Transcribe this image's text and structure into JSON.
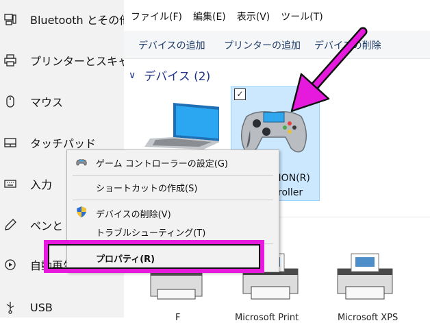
{
  "sidebar": {
    "items": [
      {
        "label": "Bluetooth とその他",
        "icon": "bluetooth-devices-icon"
      },
      {
        "label": "プリンターとスキャナー",
        "icon": "printer-icon"
      },
      {
        "label": "マウス",
        "icon": "mouse-icon"
      },
      {
        "label": "タッチパッド",
        "icon": "touchpad-icon"
      },
      {
        "label": "入力",
        "icon": "keyboard-icon"
      },
      {
        "label": "ペンと W",
        "icon": "pen-icon"
      },
      {
        "label": "自動再生",
        "icon": "autoplay-icon"
      },
      {
        "label": "USB",
        "icon": "usb-icon"
      }
    ]
  },
  "menubar": {
    "items": [
      "ファイル(F)",
      "編集(E)",
      "表示(V)",
      "ツール(T)"
    ]
  },
  "toolbar": {
    "add_device": "デバイスの追加",
    "add_printer": "プリンターの追加",
    "remove_device": "デバイスの削除"
  },
  "devices": {
    "group_title": "デバイス (2)",
    "controller_label_1": "TION(R)",
    "controller_label_2": "roller",
    "checkbox_mark": "✓"
  },
  "context_menu": {
    "items": [
      {
        "label": "ゲーム コントローラーの設定(G)",
        "icon": "gamepad-icon"
      },
      {
        "label": "ショートカットの作成(S)"
      },
      {
        "label": "デバイスの削除(V)",
        "icon": "uac-shield-icon"
      },
      {
        "label": "トラブルシューティング(T)"
      },
      {
        "label": "プロパティ(R)"
      }
    ]
  },
  "printers": {
    "labels": [
      "F",
      "Microsoft Print",
      "Microsoft XPS"
    ]
  },
  "annotation": {
    "arrow_color": "#e61adc",
    "highlight_color": "#e61adc"
  }
}
